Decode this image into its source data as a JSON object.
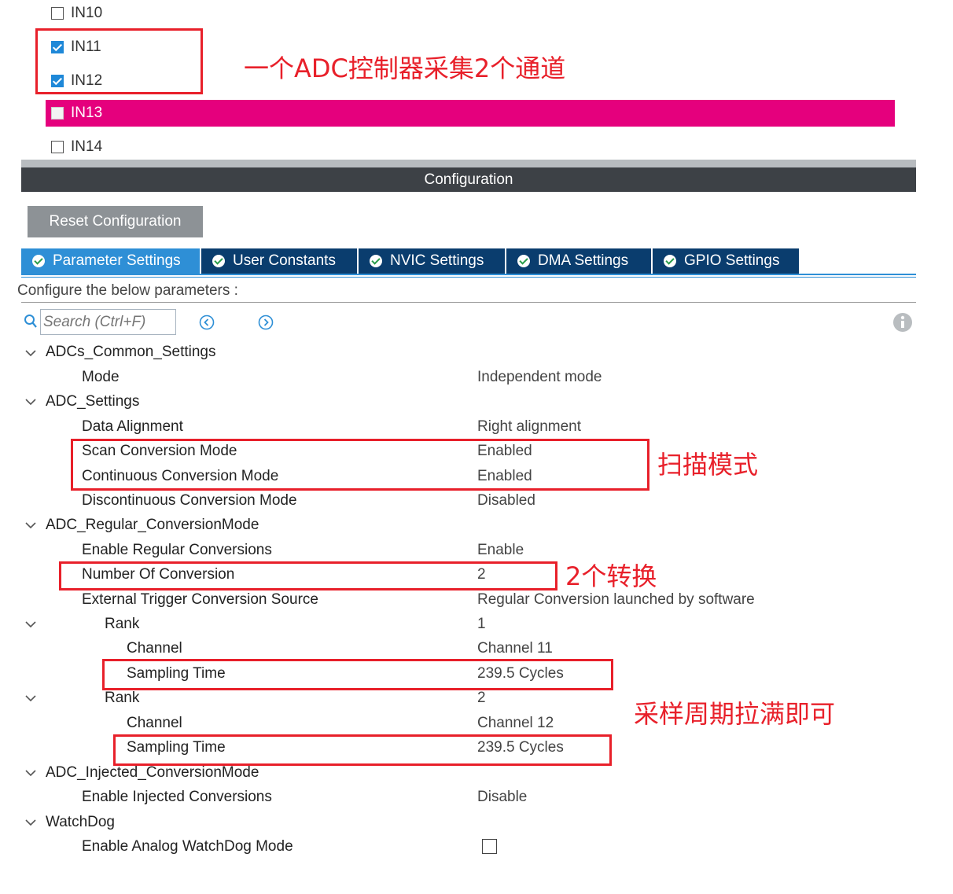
{
  "channels": [
    {
      "label": "IN10",
      "checked": false,
      "selected": false
    },
    {
      "label": "IN11",
      "checked": true,
      "selected": false
    },
    {
      "label": "IN12",
      "checked": true,
      "selected": false
    },
    {
      "label": "IN13",
      "checked": false,
      "selected": true
    },
    {
      "label": "IN14",
      "checked": false,
      "selected": false
    }
  ],
  "config_title": "Configuration",
  "reset_label": "Reset Configuration",
  "tabs": [
    {
      "label": "Parameter Settings",
      "active": true
    },
    {
      "label": "User Constants",
      "active": false
    },
    {
      "label": "NVIC Settings",
      "active": false
    },
    {
      "label": "DMA Settings",
      "active": false
    },
    {
      "label": "GPIO Settings",
      "active": false
    }
  ],
  "configure_label": "Configure the below parameters :",
  "search": {
    "placeholder": "Search (Ctrl+F)"
  },
  "params": {
    "adcs_common": {
      "header": "ADCs_Common_Settings",
      "mode_label": "Mode",
      "mode_value": "Independent mode"
    },
    "adc_settings": {
      "header": "ADC_Settings",
      "align_label": "Data Alignment",
      "align_value": "Right alignment",
      "scan_label": "Scan Conversion Mode",
      "scan_value": "Enabled",
      "cont_label": "Continuous Conversion Mode",
      "cont_value": "Enabled",
      "discont_label": "Discontinuous Conversion Mode",
      "discont_value": "Disabled"
    },
    "regular": {
      "header": "ADC_Regular_ConversionMode",
      "enable_label": "Enable Regular Conversions",
      "enable_value": "Enable",
      "num_label": "Number Of Conversion",
      "num_value": "2",
      "trigger_label": "External Trigger Conversion Source",
      "trigger_value": "Regular Conversion launched by software",
      "ranks": [
        {
          "rank_label": "Rank",
          "rank_value": "1",
          "channel_label": "Channel",
          "channel_value": "Channel 11",
          "sampling_label": "Sampling Time",
          "sampling_value": "239.5 Cycles"
        },
        {
          "rank_label": "Rank",
          "rank_value": "2",
          "channel_label": "Channel",
          "channel_value": "Channel 12",
          "sampling_label": "Sampling Time",
          "sampling_value": "239.5 Cycles"
        }
      ]
    },
    "injected": {
      "header": "ADC_Injected_ConversionMode",
      "enable_label": "Enable Injected Conversions",
      "enable_value": "Disable"
    },
    "watchdog": {
      "header": "WatchDog",
      "analog_label": "Enable Analog WatchDog Mode",
      "analog_checked": false
    }
  },
  "annotations": {
    "channels_note": "一个ADC控制器采集2个通道",
    "scan_note": "扫描模式",
    "conversion_note": "2个转换",
    "sampling_note": "采样周期拉满即可"
  },
  "colors": {
    "selected_row": "#e5007d",
    "annotation_red": "#e8202a",
    "tab_active": "#2e8fd6",
    "tab_inactive": "#0a3d6e",
    "config_bar": "#3d4146"
  }
}
